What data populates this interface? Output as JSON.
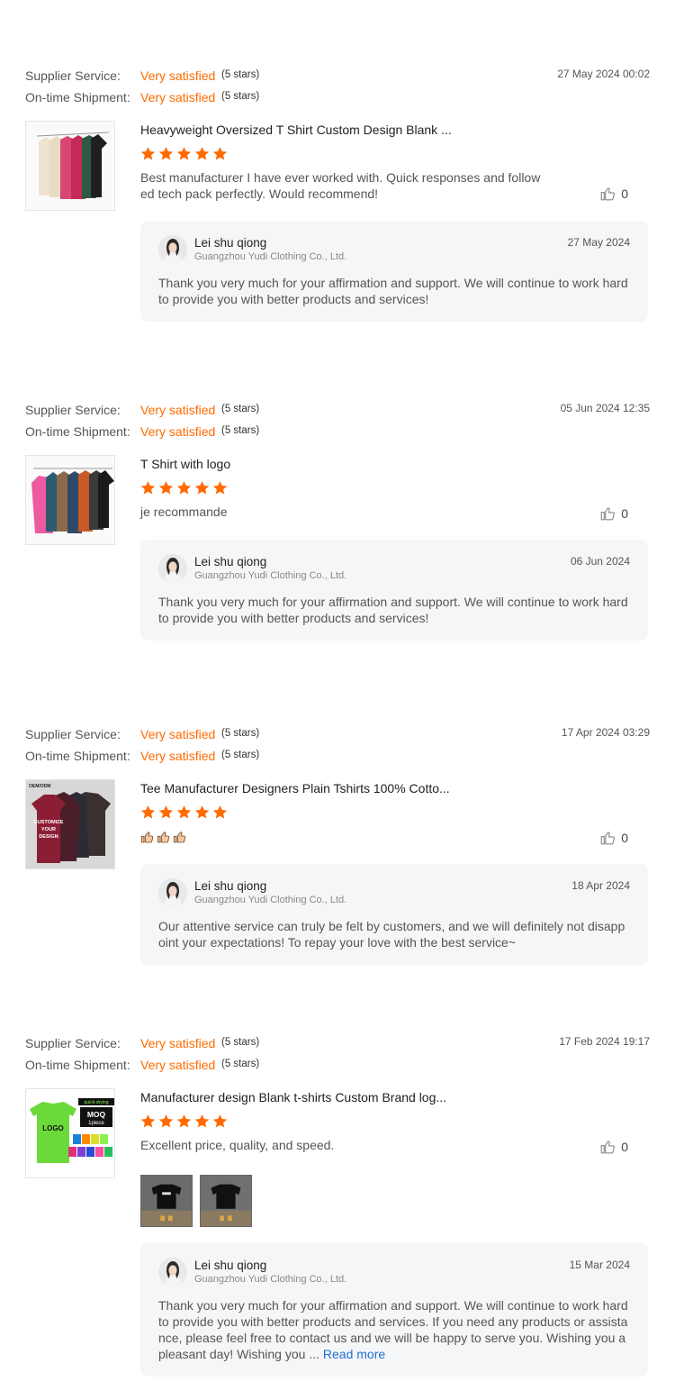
{
  "labels": {
    "supplier_service": "Supplier Service:",
    "on_time_shipment": "On-time Shipment:"
  },
  "reviews": [
    {
      "supplier_service": "Very satisfied",
      "supplier_service_stars": "(5 stars)",
      "on_time_shipment": "Very satisfied",
      "on_time_shipment_stars": "(5 stars)",
      "date": "27 May 2024 00:02",
      "product_title": "Heavyweight Oversized T Shirt Custom Design Blank ...",
      "rating": 5,
      "comment": "Best manufacturer I have ever worked with. Quick responses and followed tech pack perfectly. Would recommend!",
      "likes": "0",
      "reply": {
        "name": "Lei shu qiong",
        "company": "Guangzhou Yudi Clothing Co., Ltd.",
        "date": "27 May 2024",
        "text": "Thank you very much for your affirmation and support. We will continue to work hard to provide you with better products and services!"
      }
    },
    {
      "supplier_service": "Very satisfied",
      "supplier_service_stars": "(5 stars)",
      "on_time_shipment": "Very satisfied",
      "on_time_shipment_stars": "(5 stars)",
      "date": "05 Jun 2024 12:35",
      "product_title": "T Shirt with logo",
      "rating": 5,
      "comment": "je recommande",
      "likes": "0",
      "reply": {
        "name": "Lei shu qiong",
        "company": "Guangzhou Yudi Clothing Co., Ltd.",
        "date": "06 Jun 2024",
        "text": "Thank you very much for your affirmation and support. We will continue to work hard to provide you with better products and services!"
      }
    },
    {
      "supplier_service": "Very satisfied",
      "supplier_service_stars": "(5 stars)",
      "on_time_shipment": "Very satisfied",
      "on_time_shipment_stars": "(5 stars)",
      "date": "17 Apr 2024 03:29",
      "product_title": "Tee Manufacturer Designers Plain Tshirts 100% Cotto...",
      "rating": 5,
      "comment_emojis": [
        "thumbs-up-emoji",
        "thumbs-up-emoji",
        "thumbs-up-emoji"
      ],
      "thumb_text": {
        "banner": "OEM/ODM",
        "line1": "CUSTOMIZE",
        "line2": "YOUR",
        "line3": "DESIGN"
      },
      "likes": "0",
      "reply": {
        "name": "Lei shu qiong",
        "company": "Guangzhou Yudi Clothing Co., Ltd.",
        "date": "18 Apr 2024",
        "text": "Our attentive service can truly be felt by customers, and we will definitely not disappoint your expectations! To repay your love with the best service~"
      }
    },
    {
      "supplier_service": "Very satisfied",
      "supplier_service_stars": "(5 stars)",
      "on_time_shipment": "Very satisfied",
      "on_time_shipment_stars": "(5 stars)",
      "date": "17 Feb 2024 19:17",
      "product_title": "Manufacturer design Blank t-shirts Custom Brand log...",
      "rating": 5,
      "comment": "Excellent price, quality, and speed.",
      "thumb_text": {
        "logo": "LOGO",
        "badge": "quick-drying",
        "moq": "MOQ",
        "moq_qty": "1piece"
      },
      "likes": "0",
      "reply": {
        "name": "Lei shu qiong",
        "company": "Guangzhou Yudi Clothing Co., Ltd.",
        "date": "15 Mar 2024",
        "text": "Thank you very much for your affirmation and support. We will continue to work hard to provide you with better products and services. If you need any products or assistance, please feel free to contact us and we will be happy to serve you. Wishing you a pleasant day! Wishing you ...",
        "read_more": "Read more"
      }
    }
  ],
  "colors": {
    "accent": "#ff6a00",
    "link": "#1f6fd0",
    "reply_bg": "#f5f6f8"
  }
}
